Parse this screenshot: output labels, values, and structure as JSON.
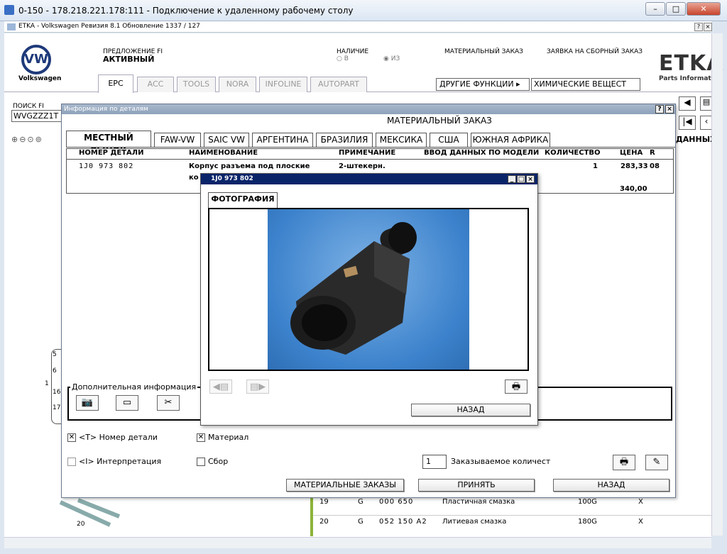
{
  "remote_desktop": {
    "title": "0-150 - 178.218.221.178:111 - Подключение к удаленному рабочему столу"
  },
  "etka": {
    "title": "ETKA - Volkswagen Ревизия 8.1 Обновление 1337 / 127",
    "brand": "Volkswagen",
    "logo_text": "ETKA",
    "logo_sub": "Parts Informat",
    "proposal_label": "ПРЕДЛОЖЕНИЕ FI",
    "proposal_value": "АКТИВНЫЙ",
    "availability_label": "НАЛИЧИЕ",
    "avail_in": "В",
    "avail_from": "ИЗ",
    "material_order_label": "МАТЕРИАЛЬНЫЙ ЗАКАЗ",
    "assembly_order_label": "ЗАЯВКА НА СБОРНЫЙ ЗАКАЗ",
    "other_functions": "ДРУГИЕ ФУНКЦИИ",
    "chemicals": "ХИМИЧЕСКИЕ ВЕЩЕСТ",
    "search_label": "ПОИСК FI",
    "search_value": "WVGZZZ1T",
    "data_label": "ДАННЫХ",
    "tabs": [
      "EPC",
      "ACC",
      "TOOLS",
      "NORA",
      "INFOLINE",
      "AUTOPART"
    ],
    "bg_rows": [
      {
        "pos": "19",
        "g": "G",
        "part": "000 650",
        "name": "Пластичная смазка",
        "qty": "100G",
        "x": "X"
      },
      {
        "pos": "20",
        "g": "G",
        "part": "052 150 A2",
        "name": "Литиевая смазка",
        "qty": "180G",
        "x": "X"
      }
    ],
    "left_nums": [
      "5",
      "6",
      "1",
      "16",
      "17",
      "20"
    ]
  },
  "details_dialog": {
    "title": "Информация по деталям",
    "heading": "МАТЕРИАЛЬНЫЙ ЗАКАЗ",
    "tabs": [
      "МЕСТНЫЙ РЫНОК",
      "FAW-VW",
      "SAIC VW",
      "АРГЕНТИНА",
      "БРАЗИЛИЯ",
      "МЕКСИКА",
      "США",
      "ЮЖНАЯ АФРИКА"
    ],
    "columns": [
      "НОМЕР ДЕТАЛИ",
      "НАИМЕНОВАНИЕ",
      "ПРИМЕЧАНИЕ",
      "ВВОД ДАННЫХ ПО МОДЕЛИ",
      "КОЛИЧЕСТВО",
      "ЦЕНА",
      "R"
    ],
    "row": {
      "part": "1J0 973 802",
      "name1": "Корпус разъема под плоские",
      "name2": "ко",
      "note": "2-штекерн.",
      "qty": "1",
      "price": "283,33",
      "r": "08",
      "total": "340,00"
    },
    "extra_info": "Дополнительная информация",
    "opt_part_number": "<T> Номер детали",
    "opt_material": "Материал",
    "opt_interpretation": "<I> Интерпретация",
    "opt_assembly": "Сбор",
    "order_qty_value": "1",
    "order_qty_label": "Заказываемое количест",
    "btn_orders": "МАТЕРИАЛЬНЫЕ ЗАКАЗЫ",
    "btn_accept": "ПРИНЯТЬ",
    "btn_back": "НАЗАД"
  },
  "photo_dialog": {
    "title": "1J0 973 802",
    "tab": "ФОТОГРАФИЯ",
    "btn_back": "НАЗАД"
  },
  "colors": {
    "title_bar": "#0a246a",
    "photo_bg": "#3c82cc",
    "accent_green": "#8db33a"
  }
}
